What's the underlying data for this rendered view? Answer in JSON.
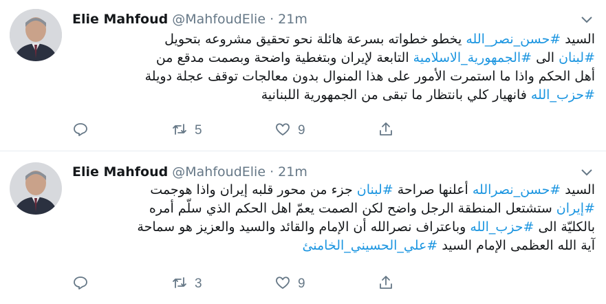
{
  "tweets": [
    {
      "author": {
        "name": "Elie Mahfoud",
        "handle": "@MahfoudElie",
        "time": "21m"
      },
      "lines": [
        [
          {
            "t": "السيد "
          },
          {
            "t": "#حسن_نصر_الله",
            "tag": true
          },
          {
            "t": " يخطو خطواته بسرعة هائلة نحو تحقيق مشروعه بتحويل"
          }
        ],
        [
          {
            "t": "#لبنان",
            "tag": true
          },
          {
            "t": " الى "
          },
          {
            "t": "#الجمهورية_الاسلامية",
            "tag": true
          },
          {
            "t": " التابعة لإيران وبتغطية واضحة وبصمت مدقع من"
          }
        ],
        [
          {
            "t": "أهل الحكم واذا ما استمرت الأمور على هذا المنوال بدون معالجات توقف عجلة دويلة"
          }
        ],
        [
          {
            "t": "#حزب_الله",
            "tag": true
          },
          {
            "t": " فانهيار كلي بانتظار ما تبقى من الجمهورية اللبنانية"
          }
        ]
      ],
      "stats": {
        "replies": "",
        "retweets": "5",
        "likes": "9"
      }
    },
    {
      "author": {
        "name": "Elie Mahfoud",
        "handle": "@MahfoudElie",
        "time": "21m"
      },
      "lines": [
        [
          {
            "t": "السيد "
          },
          {
            "t": "#حسن_نصرالله",
            "tag": true
          },
          {
            "t": " أعلنها صراحة "
          },
          {
            "t": "#لبنان",
            "tag": true
          },
          {
            "t": " جزء من محور قلبه إيران واذا هوجمت"
          }
        ],
        [
          {
            "t": "#إيران",
            "tag": true
          },
          {
            "t": " ستشتعل المنطقة الرجل واضح لكن الصمت يعمّ اهل الحكم الذي سلّم أمره"
          }
        ],
        [
          {
            "t": "بالكليّة الى  "
          },
          {
            "t": "#حزب_الله",
            "tag": true
          },
          {
            "t": " وباعتراف نصرالله أن الإمام والقائد والسيد والعزيز هو سماحة"
          }
        ],
        [
          {
            "t": "آية الله العظمى الإمام السيد "
          },
          {
            "t": "#علي_الحسيني_الخامنئ",
            "tag": true
          }
        ]
      ],
      "stats": {
        "replies": "",
        "retweets": "3",
        "likes": "9"
      }
    }
  ],
  "separator": "·",
  "colors": {
    "link": "#1b95e0",
    "text": "#14171a",
    "muted": "#657786",
    "divider": "#e6ecf0"
  },
  "icons": {
    "reply": "reply-icon",
    "retweet": "retweet-icon",
    "like": "like-icon",
    "share": "share-icon",
    "menu": "chevron-down-icon"
  }
}
